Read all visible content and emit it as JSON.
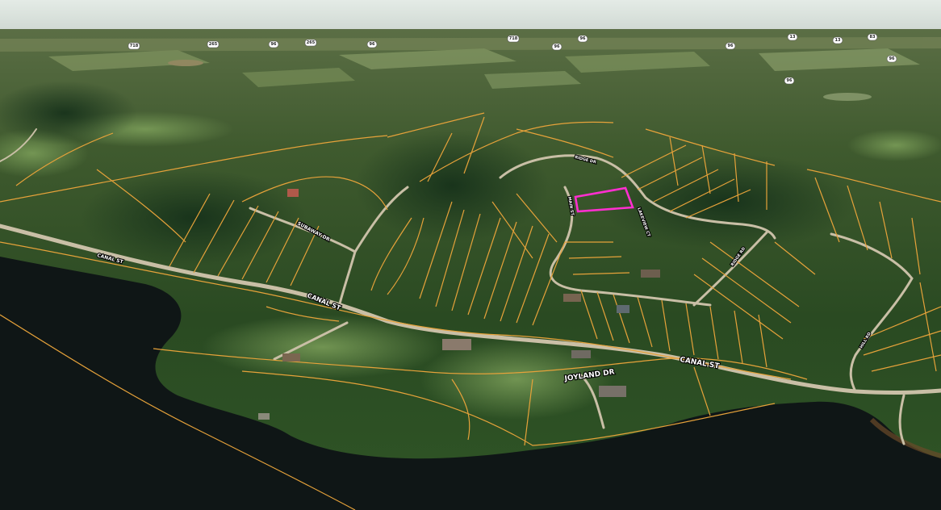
{
  "map": {
    "view": "3D oblique satellite view",
    "highlight_color": "#ff2fd0",
    "parcel_color": "#e6a23a",
    "water_color": "#0e1414",
    "sky_color": "#dfe6e0"
  },
  "road_labels": {
    "canal_st_left": "CANAL ST",
    "canal_st_right": "CANAL ST",
    "joyland_dr": "JOYLAND DR",
    "left_shore_road": "CANAL ST",
    "hillside_road": "SUBAWAY DR",
    "upper_road": "RIDGE DR",
    "vertical_road_a": "MAIN ST",
    "vertical_road_b": "LAKEVIEW CT",
    "right_road": "RIDGE RD",
    "far_right_road": "HILL RD"
  },
  "highway_shields": [
    {
      "label": "718"
    },
    {
      "label": "265"
    },
    {
      "label": "96"
    },
    {
      "label": "265"
    },
    {
      "label": "96"
    },
    {
      "label": "718"
    },
    {
      "label": "96"
    },
    {
      "label": "96"
    },
    {
      "label": "96"
    },
    {
      "label": "13"
    },
    {
      "label": "13"
    },
    {
      "label": "83"
    },
    {
      "label": "96"
    },
    {
      "label": "96"
    }
  ]
}
